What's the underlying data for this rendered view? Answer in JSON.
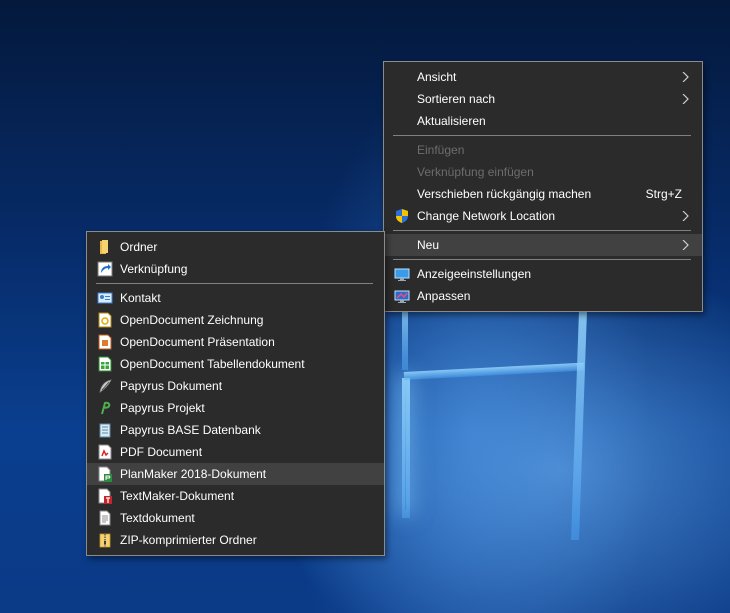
{
  "desktop_menu": {
    "items": [
      {
        "label": "Ansicht"
      },
      {
        "label": "Sortieren nach"
      },
      {
        "label": "Aktualisieren"
      },
      {
        "label": "Einfügen"
      },
      {
        "label": "Verknüpfung einfügen"
      },
      {
        "label": "Verschieben rückgängig machen",
        "shortcut": "Strg+Z"
      },
      {
        "label": "Change Network Location"
      },
      {
        "label": "Neu"
      },
      {
        "label": "Anzeigeeinstellungen"
      },
      {
        "label": "Anpassen"
      }
    ]
  },
  "new_submenu": {
    "items": [
      {
        "label": "Ordner"
      },
      {
        "label": "Verknüpfung"
      },
      {
        "label": "Kontakt"
      },
      {
        "label": "OpenDocument Zeichnung"
      },
      {
        "label": "OpenDocument Präsentation"
      },
      {
        "label": "OpenDocument Tabellendokument"
      },
      {
        "label": "Papyrus Dokument"
      },
      {
        "label": "Papyrus Projekt"
      },
      {
        "label": "Papyrus BASE Datenbank"
      },
      {
        "label": "PDF Document"
      },
      {
        "label": "PlanMaker 2018-Dokument"
      },
      {
        "label": "TextMaker-Dokument"
      },
      {
        "label": "Textdokument"
      },
      {
        "label": "ZIP-komprimierter Ordner"
      }
    ]
  }
}
